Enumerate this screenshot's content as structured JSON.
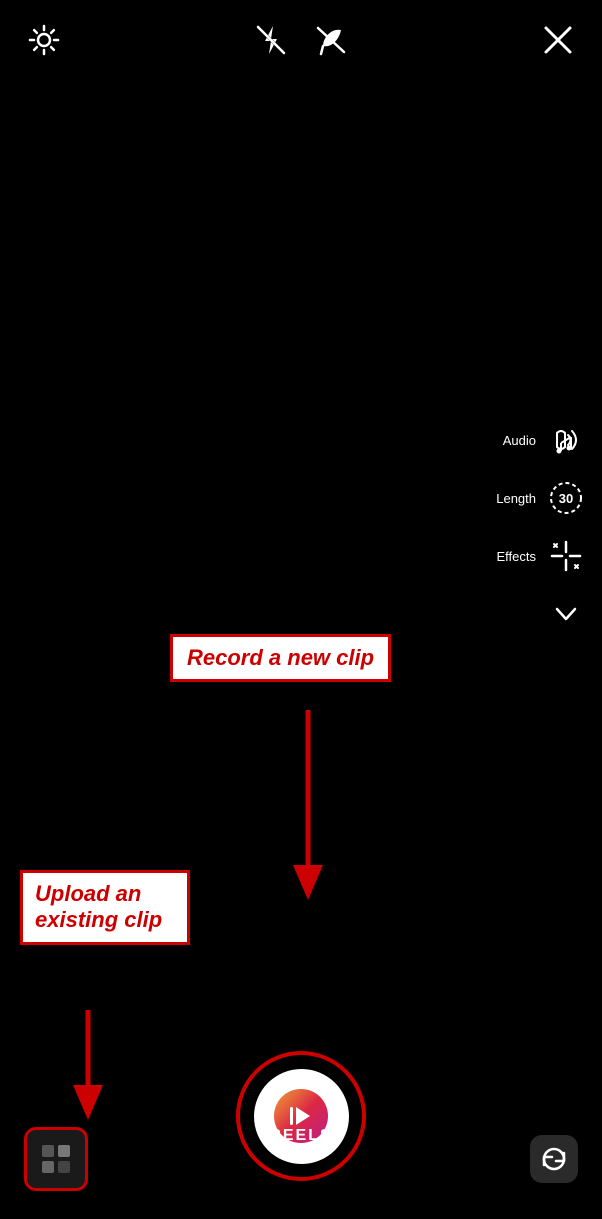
{
  "topBar": {
    "brightnessIcon": "brightness-icon",
    "flashOffIcon": "flash-off-icon",
    "noSoundIcon": "no-sound-icon",
    "closeIcon": "close-icon"
  },
  "rightTools": {
    "audioLabel": "Audio",
    "lengthLabel": "Length",
    "lengthValue": "30",
    "effectsLabel": "Effects"
  },
  "annotations": {
    "recordLabel": "Record a new clip",
    "uploadLabel": "Upload an existing clip"
  },
  "bottomBar": {
    "reelsLabel": "REELS"
  }
}
